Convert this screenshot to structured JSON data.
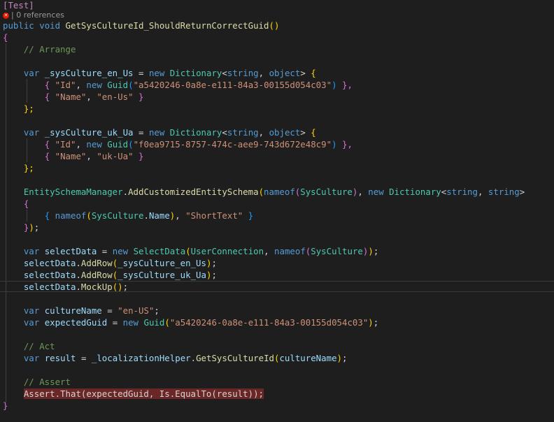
{
  "codelens": {
    "icon": "error-icon",
    "text": "| 0 references"
  },
  "lines": {
    "attr": "[Test]",
    "sig_kw1": "public",
    "sig_kw2": "void",
    "sig_name": "GetSysCultureId_ShouldReturnCorrectGuid",
    "sig_parens": "()",
    "open_brace": "{",
    "c_arrange": "// Arrange",
    "v1_var": "var",
    "v1_name": "_sysCulture_en_Us",
    "v1_eq": "=",
    "v1_new": "new",
    "v1_type": "Dictionary",
    "v1_lt": "<",
    "v1_t1": "string",
    "v1_comma": ",",
    "v1_t2": "object",
    "v1_gt": ">",
    "v1_brace": "{",
    "v1a_open": "{",
    "v1a_key": "\"Id\"",
    "v1a_comma": ",",
    "v1a_new": "new",
    "v1a_type": "Guid",
    "v1a_lp": "(",
    "v1a_val": "\"a5420246-0a8e-e111-84a3-00155d054c03\"",
    "v1a_rp": ")",
    "v1a_close": "},",
    "v1b_open": "{",
    "v1b_key": "\"Name\"",
    "v1b_comma": ",",
    "v1b_val": "\"en-Us\"",
    "v1b_close": "}",
    "v1_end": "};",
    "v2_var": "var",
    "v2_name": "_sysCulture_uk_Ua",
    "v2_eq": "=",
    "v2_new": "new",
    "v2_type": "Dictionary",
    "v2_lt": "<",
    "v2_t1": "string",
    "v2_comma": ",",
    "v2_t2": "object",
    "v2_gt": ">",
    "v2_brace": "{",
    "v2a_open": "{",
    "v2a_key": "\"Id\"",
    "v2a_comma": ",",
    "v2a_new": "new",
    "v2a_type": "Guid",
    "v2a_lp": "(",
    "v2a_val": "\"f0ea9715-8757-474c-aee9-743d672e48c9\"",
    "v2a_rp": ")",
    "v2a_close": "},",
    "v2b_open": "{",
    "v2b_key": "\"Name\"",
    "v2b_comma": ",",
    "v2b_val": "\"uk-Ua\"",
    "v2b_close": "}",
    "v2_end": "};",
    "esm_obj": "EntitySchemaManager",
    "esm_dot": ".",
    "esm_fn": "AddCustomizedEntitySchema",
    "esm_lp": "(",
    "esm_nameof": "nameof",
    "esm_lp2": "(",
    "esm_arg": "SysCulture",
    "esm_rp2": ")",
    "esm_comma": ",",
    "esm_new": "new",
    "esm_type": "Dictionary",
    "esm_lt": "<",
    "esm_t1": "string",
    "esm_comma2": ",",
    "esm_t2": "string",
    "esm_gt": ">",
    "esm_brace": "{",
    "esm_i_open": "{",
    "esm_i_nameof": "nameof",
    "esm_i_lp": "(",
    "esm_i_obj": "SysCulture",
    "esm_i_dot": ".",
    "esm_i_prop": "Name",
    "esm_i_rp": ")",
    "esm_i_comma": ",",
    "esm_i_val": "\"ShortText\"",
    "esm_i_close": "}",
    "esm_end_b": "}",
    "esm_end_p": ")",
    "esm_end_s": ";",
    "sd_var": "var",
    "sd_name": "selectData",
    "sd_eq": "=",
    "sd_new": "new",
    "sd_type": "SelectData",
    "sd_lp": "(",
    "sd_arg1": "UserConnection",
    "sd_comma": ",",
    "sd_nameof": "nameof",
    "sd_lp2": "(",
    "sd_arg2": "SysCulture",
    "sd_rp2": ")",
    "sd_rp": ")",
    "sd_semi": ";",
    "ar1_obj": "selectData",
    "ar1_dot": ".",
    "ar1_fn": "AddRow",
    "ar1_lp": "(",
    "ar1_arg": "_sysCulture_en_Us",
    "ar1_rp": ")",
    "ar1_semi": ";",
    "ar2_obj": "selectData",
    "ar2_dot": ".",
    "ar2_fn": "AddRow",
    "ar2_lp": "(",
    "ar2_arg": "_sysCulture_uk_Ua",
    "ar2_rp": ")",
    "ar2_semi": ";",
    "mu_obj": "selectData",
    "mu_dot": ".",
    "mu_fn": "MockUp",
    "mu_parens": "()",
    "mu_semi": ";",
    "cn_var": "var",
    "cn_name": "cultureName",
    "cn_eq": "=",
    "cn_val": "\"en-US\"",
    "cn_semi": ";",
    "eg_var": "var",
    "eg_name": "expectedGuid",
    "eg_eq": "=",
    "eg_new": "new",
    "eg_type": "Guid",
    "eg_lp": "(",
    "eg_val": "\"a5420246-0a8e-e111-84a3-00155d054c03\"",
    "eg_rp": ")",
    "eg_semi": ";",
    "c_act": "// Act",
    "r_var": "var",
    "r_name": "result",
    "r_eq": "=",
    "r_obj": "_localizationHelper",
    "r_dot": ".",
    "r_fn": "GetSysCultureId",
    "r_lp": "(",
    "r_arg": "cultureName",
    "r_rp": ")",
    "r_semi": ";",
    "c_assert": "// Assert",
    "as_text": "Assert.That(expectedGuid, Is.EqualTo(result));",
    "close_brace": "}"
  }
}
